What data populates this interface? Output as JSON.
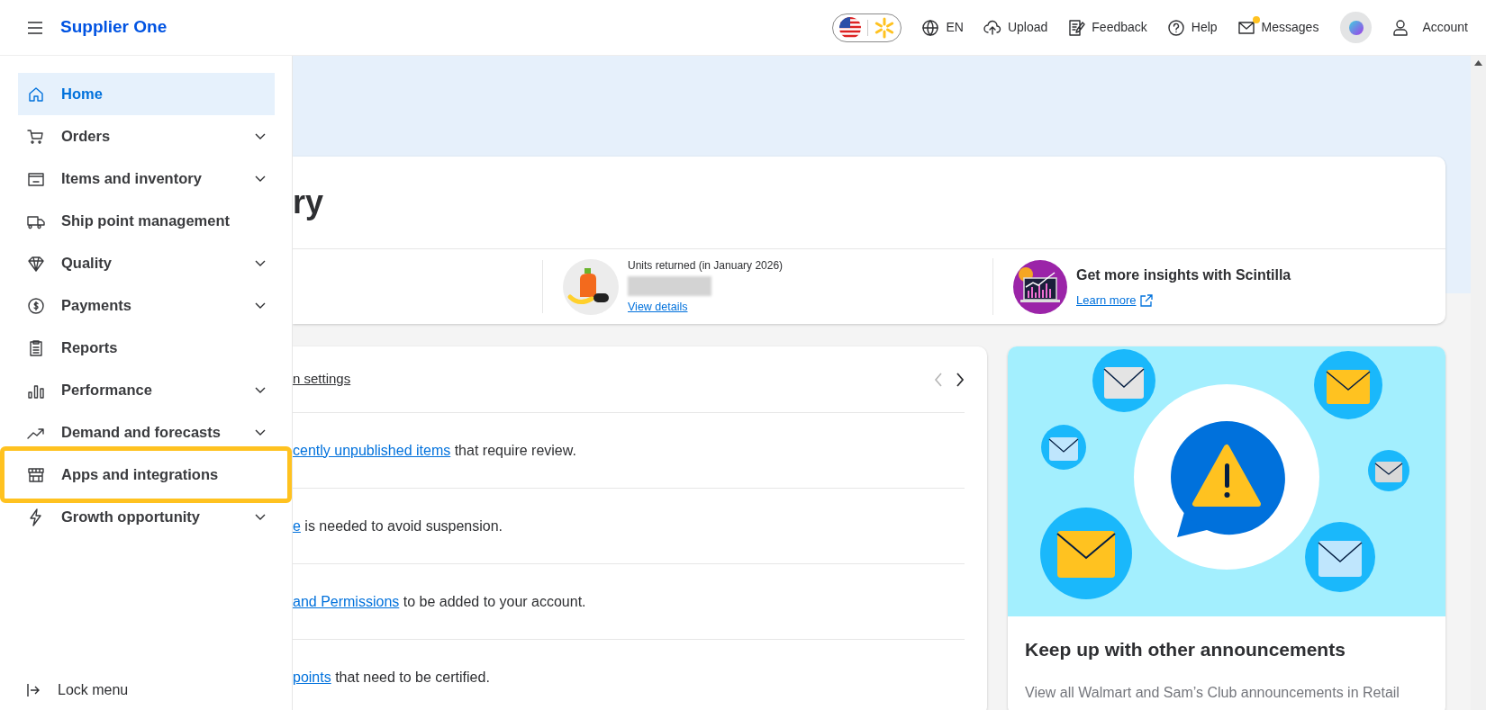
{
  "header": {
    "logo": "Supplier One",
    "nav": [
      {
        "kind": "language",
        "label": "EN"
      },
      {
        "kind": "upload",
        "label": "Upload"
      },
      {
        "kind": "feedback",
        "label": "Feedback"
      },
      {
        "kind": "help",
        "label": "Help"
      },
      {
        "kind": "messages",
        "label": "Messages",
        "unread": true
      },
      {
        "kind": "avatar"
      },
      {
        "kind": "account",
        "label": "Account"
      }
    ]
  },
  "sidebar": {
    "items": [
      {
        "label": "Home",
        "selected": true,
        "expandable": false,
        "highlighted": false
      },
      {
        "label": "Orders",
        "selected": false,
        "expandable": true,
        "highlighted": false
      },
      {
        "label": "Items and inventory",
        "selected": false,
        "expandable": true,
        "highlighted": false
      },
      {
        "label": "Ship point management",
        "selected": false,
        "expandable": false,
        "highlighted": false
      },
      {
        "label": "Quality",
        "selected": false,
        "expandable": true,
        "highlighted": false
      },
      {
        "label": "Payments",
        "selected": false,
        "expandable": true,
        "highlighted": false
      },
      {
        "label": "Reports",
        "selected": false,
        "expandable": false,
        "highlighted": false
      },
      {
        "label": "Performance",
        "selected": false,
        "expandable": true,
        "highlighted": false
      },
      {
        "label": "Demand and forecasts",
        "selected": false,
        "expandable": true,
        "highlighted": false
      },
      {
        "label": "Apps and integrations",
        "selected": false,
        "expandable": false,
        "highlighted": true
      },
      {
        "label": "Growth opportunity",
        "selected": false,
        "expandable": true,
        "highlighted": false
      }
    ],
    "footer": {
      "label": "Lock menu"
    }
  },
  "summary_card": {
    "title": "ry",
    "stats": [
      {
        "kind": "returns",
        "label": "Units returned (in January 2026)",
        "link": "View details"
      },
      {
        "kind": "insights",
        "title": "Get more insights with Scintilla",
        "link": "Learn more"
      }
    ]
  },
  "notifications": {
    "header_link": "n settings",
    "rows": [
      {
        "link": "cently unpublished items",
        "text": " that require review."
      },
      {
        "link": "e",
        "text": " is needed to avoid suspension."
      },
      {
        "link": "and Permissions",
        "text": " to be added to your account."
      },
      {
        "link": "points",
        "text": " that need to be certified."
      }
    ]
  },
  "announcement": {
    "title": "Keep up with other announcements",
    "text": "View all Walmart and Sam’s Club announcements in Retail"
  }
}
